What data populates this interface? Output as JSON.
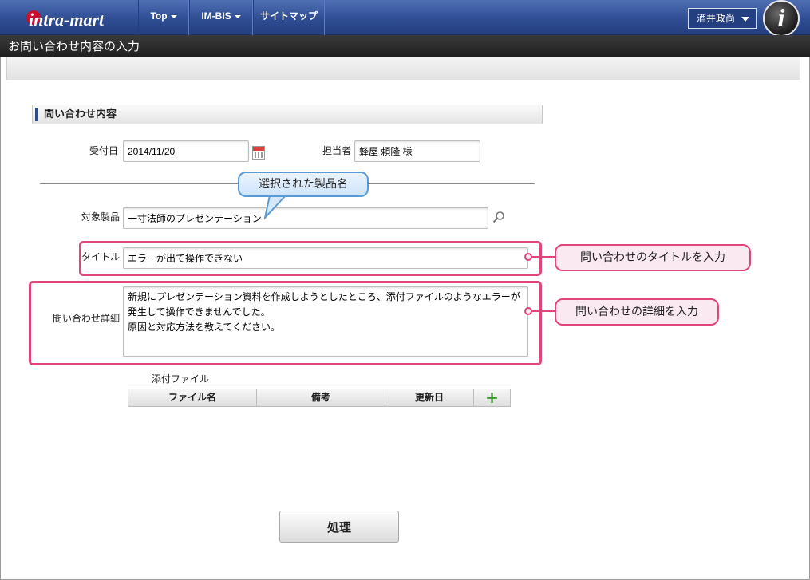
{
  "nav": {
    "logo_text": "intra-mart",
    "items": [
      {
        "label": "Top",
        "has_caret": true
      },
      {
        "label": "IM-BIS",
        "has_caret": true
      },
      {
        "label": "サイトマップ",
        "has_caret": false
      }
    ],
    "user": "酒井政尚",
    "avatar_letter": "i"
  },
  "page_title": "お問い合わせ内容の入力",
  "section_title": "問い合わせ内容",
  "form": {
    "received_date_label": "受付日",
    "received_date": "2014/11/20",
    "assignee_label": "担当者",
    "assignee": "蜂屋 頼隆 様",
    "product_label": "対象製品",
    "product": "一寸法師のプレゼンテーション",
    "title_label": "タイトル",
    "title": "エラーが出て操作できない",
    "detail_label": "問い合わせ詳細",
    "detail": "新規にプレゼンテーション資料を作成しようとしたところ、添付ファイルのようなエラーが発生して操作できませんでした。\n原因と対応方法を教えてください。"
  },
  "attachments": {
    "label": "添付ファイル",
    "columns": [
      "ファイル名",
      "備考",
      "更新日"
    ],
    "add_symbol": "+"
  },
  "callouts": {
    "product": "選択された製品名",
    "title": "問い合わせのタイトルを入力",
    "detail": "問い合わせの詳細を入力"
  },
  "submit_label": "処理",
  "colors": {
    "nav": "#2f4d93",
    "highlight": "#e0457b",
    "callout_blue": "#5b9bd5"
  }
}
